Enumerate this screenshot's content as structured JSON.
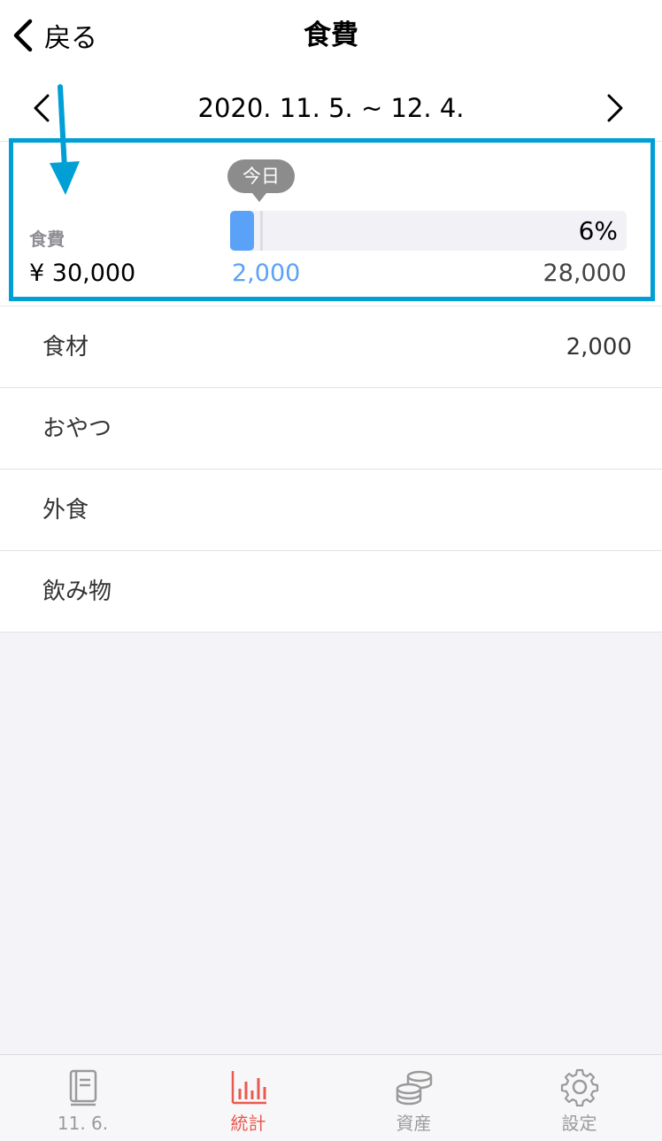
{
  "nav": {
    "back_label": "戻る",
    "title": "食費"
  },
  "period": {
    "label": "2020. 11. 5. ~ 12. 4."
  },
  "summary": {
    "category": "食費",
    "budget_total": "¥ 30,000",
    "today_label": "今日",
    "progress_percent_label": "6%",
    "progress_fraction": 0.06,
    "spent": "2,000",
    "remaining": "28,000",
    "fill_color": "#5aa2f7",
    "highlight_color": "#009fd6"
  },
  "subcategories": [
    {
      "label": "食材",
      "amount": "2,000"
    },
    {
      "label": "おやつ",
      "amount": ""
    },
    {
      "label": "外食",
      "amount": ""
    },
    {
      "label": "飲み物",
      "amount": ""
    }
  ],
  "tabs": [
    {
      "label": "11. 6.",
      "icon": "book-icon",
      "active": false
    },
    {
      "label": "統計",
      "icon": "bar-chart-icon",
      "active": true
    },
    {
      "label": "資産",
      "icon": "coins-icon",
      "active": false
    },
    {
      "label": "設定",
      "icon": "gear-icon",
      "active": false
    }
  ],
  "colors": {
    "tab_active": "#e85a4f",
    "tab_inactive": "#9a9a9a"
  }
}
